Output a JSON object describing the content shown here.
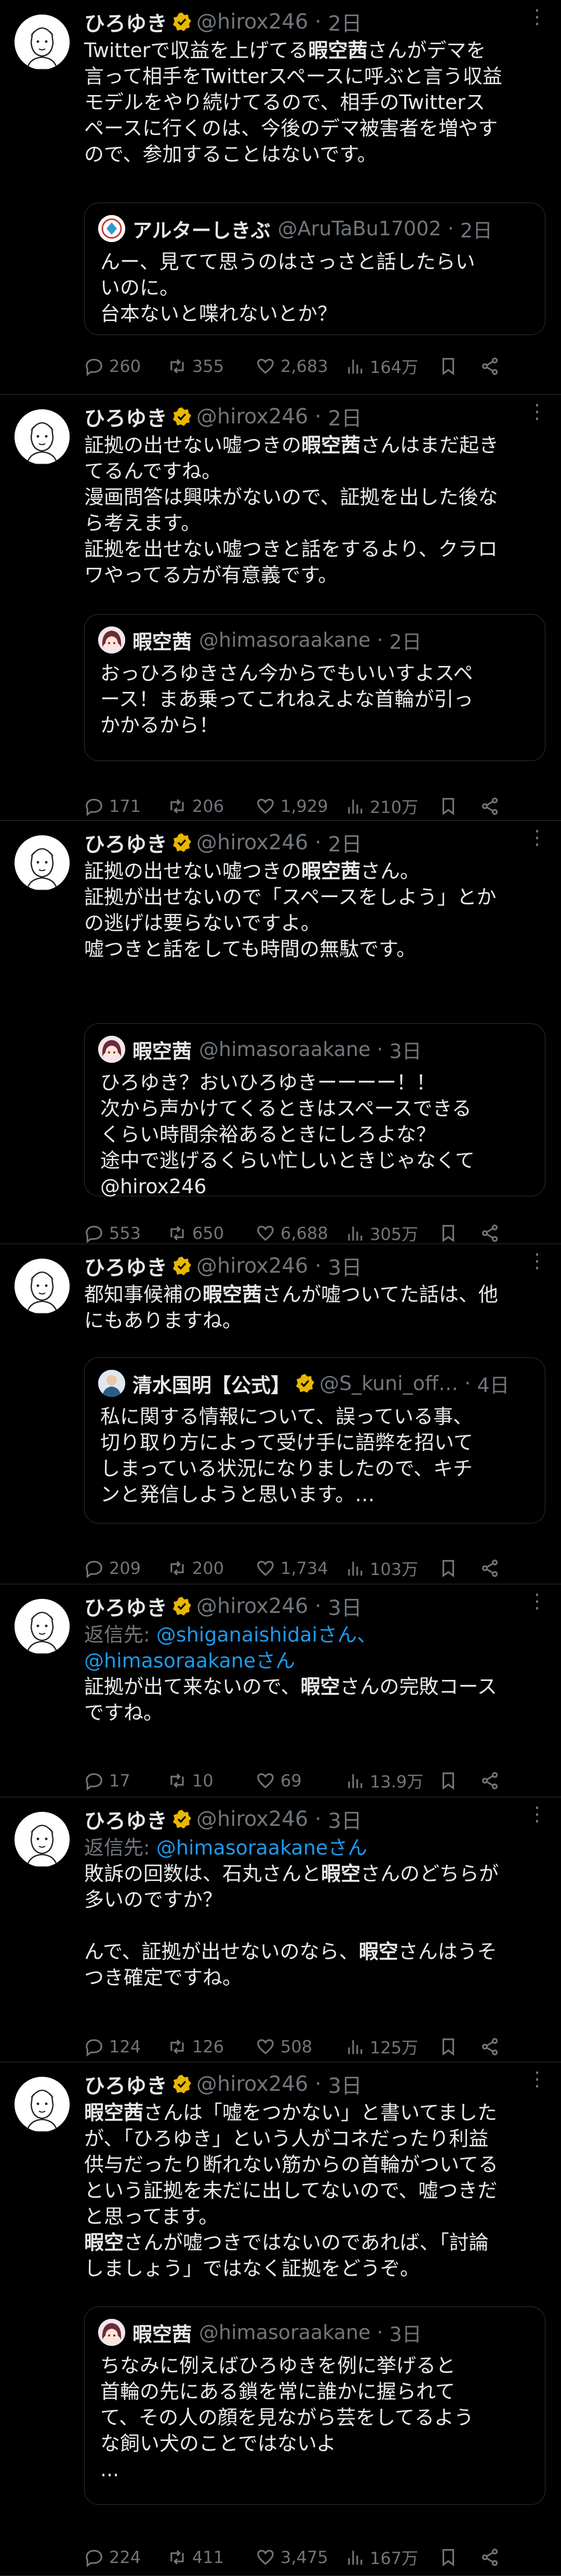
{
  "tweets": [
    {
      "name": "ひろゆき",
      "handle": "@hirox246",
      "time": "2日",
      "text_html": "Twitterで収益を上げてる<b>暇空茜</b>さんがデマを\n言って相手をTwitterスペースに呼ぶと言う収益\nモデルをやり続けてるので、相手のTwitterス\nペースに行くのは、今後のデマ被害者を増やす\nので、参加することはないです。",
      "quote": {
        "name": "アルターしきぶ",
        "handle": "@AruTaBu17002",
        "time": "2日",
        "text": "んー、見てて思うのはさっさと話したらい\nいのに。\n台本ないと喋れないとか？"
      },
      "replies": "260",
      "retweets": "355",
      "likes": "2,683",
      "views": "164万"
    },
    {
      "name": "ひろゆき",
      "handle": "@hirox246",
      "time": "2日",
      "text_html": "証拠の出せない嘘つきの<b>暇空茜</b>さんはまだ起き\nてるんですね。\n漫画問答は興味がないので、証拠を出した後な\nら考えます。\n証拠を出せない嘘つきと話をするより、クラロ\nワやってる方が有意義です。",
      "quote": {
        "name": "暇空茜",
        "handle": "@himasoraakane",
        "time": "2日",
        "text": "おっひろゆきさん今からでもいいすよスペ\nース！まあ乗ってこれねえよな首輪が引っ\nかかるから！"
      },
      "replies": "171",
      "retweets": "206",
      "likes": "1,929",
      "views": "210万"
    },
    {
      "name": "ひろゆき",
      "handle": "@hirox246",
      "time": "2日",
      "text_html": "証拠の出せない嘘つきの<b>暇空茜</b>さん。\n証拠が出せないので「スペースをしよう」とか\nの逃げは要らないですよ。\n嘘つきと話をしても時間の無駄です。",
      "quote": {
        "name": "暇空茜",
        "handle": "@himasoraakane",
        "time": "3日",
        "text": "ひろゆき？おいひろゆきーーーー！！\n次から声かけてくるときはスペースできる\nくらい時間余裕あるときにしろよな？\n途中で逃げるくらい忙しいときじゃなくて\n@hirox246"
      },
      "replies": "553",
      "retweets": "650",
      "likes": "6,688",
      "views": "305万"
    },
    {
      "name": "ひろゆき",
      "handle": "@hirox246",
      "time": "3日",
      "text_html": "都知事候補の<b>暇空茜</b>さんが嘘ついてた話は、他\nにもありますね。",
      "quote": {
        "name": "清水国明【公式】",
        "handle": "@S_kuni_off…",
        "time": "4日",
        "text": "私に関する情報について、誤っている事、\n切り取り方によって受け手に語弊を招いて\nしまっている状況になりましたので、キチ\nンと発信しようと思います。…"
      },
      "replies": "209",
      "retweets": "200",
      "likes": "1,734",
      "views": "103万"
    },
    {
      "name": "ひろゆき",
      "handle": "@hirox246",
      "time": "3日",
      "reply_prefix": "返信先: ",
      "reply_to": "@shiganaishidaiさん、\n@himasoraakaneさん",
      "text_html": "証拠が出て来ないので、<b>暇空</b>さんの完敗コース\nですね。",
      "replies": "17",
      "retweets": "10",
      "likes": "69",
      "views": "13.9万"
    },
    {
      "name": "ひろゆき",
      "handle": "@hirox246",
      "time": "3日",
      "reply_prefix": "返信先: ",
      "reply_to": "@himasoraakaneさん",
      "text_html": "敗訴の回数は、石丸さんと<b>暇空</b>さんのどちらが\n多いのですか？\n\nんで、証拠が出せないのなら、<b>暇空</b>さんはうそ\nつき確定ですね。",
      "replies": "124",
      "retweets": "126",
      "likes": "508",
      "views": "125万"
    },
    {
      "name": "ひろゆき",
      "handle": "@hirox246",
      "time": "3日",
      "text_html": "<b>暇空茜</b>さんは「嘘をつかない」と書いてました\nが、「ひろゆき」という人がコネだったり利益\n供与だったり断れない筋からの首輪がついてる\nという証拠を未だに出してないので、嘘つきだ\nと思ってます。\n<b>暇空</b>さんが嘘つきではないのであれば、「討論\nしましょう」ではなく証拠をどうぞ。",
      "quote": {
        "name": "暇空茜",
        "handle": "@himasoraakane",
        "time": "3日",
        "text": "ちなみに例えばひろゆきを例に挙げると\n首輪の先にある鎖を常に誰かに握られて\nて、その人の顔を見ながら芸をしてるよう\nな飼い犬のことではないよ\n..."
      },
      "replies": "224",
      "retweets": "411",
      "likes": "3,475",
      "views": "167万"
    }
  ]
}
